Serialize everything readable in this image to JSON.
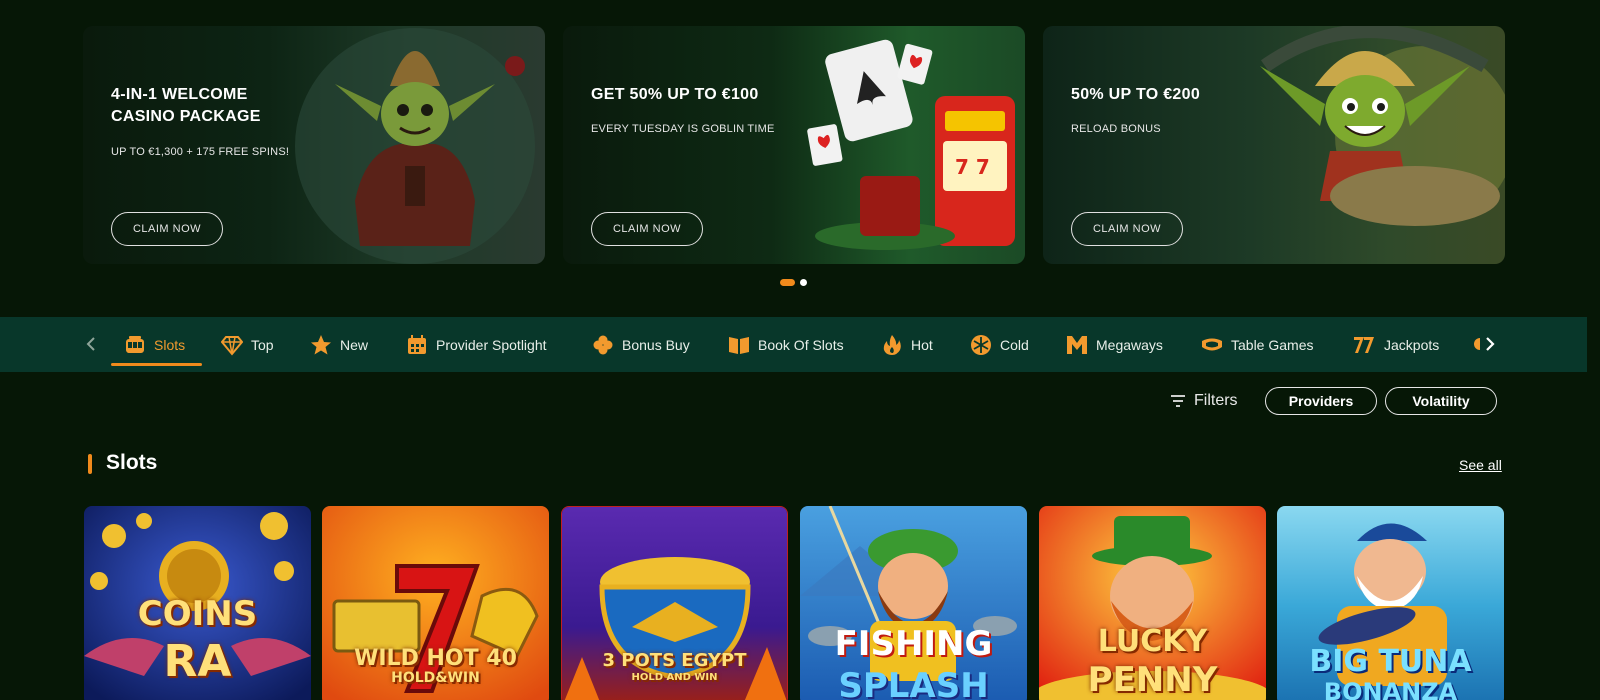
{
  "promos": [
    {
      "title_line1": "4-IN-1 WELCOME",
      "title_line2": "CASINO PACKAGE",
      "subtitle": "UP TO €1,300 + 175 FREE SPINS!",
      "cta": "CLAIM NOW"
    },
    {
      "title_line1": "GET 50% UP TO €100",
      "title_line2": "",
      "subtitle": "EVERY TUESDAY IS GOBLIN TIME",
      "cta": "CLAIM NOW"
    },
    {
      "title_line1": "50% UP TO €200",
      "title_line2": "",
      "subtitle": "RELOAD BONUS",
      "cta": "CLAIM NOW"
    }
  ],
  "carousel": {
    "pages": 2,
    "active_page": 1
  },
  "categories": [
    {
      "label": "Slots",
      "icon": "slot-machine-icon",
      "active": true
    },
    {
      "label": "Top",
      "icon": "diamond-icon"
    },
    {
      "label": "New",
      "icon": "star-icon"
    },
    {
      "label": "Provider Spotlight",
      "icon": "calendar-icon"
    },
    {
      "label": "Bonus Buy",
      "icon": "clover-icon"
    },
    {
      "label": "Book Of Slots",
      "icon": "book-icon"
    },
    {
      "label": "Hot",
      "icon": "flame-icon"
    },
    {
      "label": "Cold",
      "icon": "snowflake-icon"
    },
    {
      "label": "Megaways",
      "icon": "megaways-m-icon"
    },
    {
      "label": "Table Games",
      "icon": "table-games-icon"
    },
    {
      "label": "Jackpots",
      "icon": "sevens-icon"
    }
  ],
  "filters": {
    "label": "Filters",
    "providers": "Providers",
    "volatility": "Volatility"
  },
  "section": {
    "title": "Slots",
    "see_all": "See all"
  },
  "games": [
    {
      "line1": "COINS",
      "line2": "RA"
    },
    {
      "line1": "WILD HOT 40",
      "line2": "HOLD&WIN"
    },
    {
      "line1": "3 POTS EGYPT",
      "line2": "HOLD AND WIN"
    },
    {
      "line1": "FISHING",
      "line2": "SPLASH"
    },
    {
      "line1": "LUCKY",
      "line2": "PENNY"
    },
    {
      "line1": "BIG TUNA",
      "line2": "BONANZA"
    }
  ],
  "colors": {
    "background": "#061706",
    "nav_bar": "#08372a",
    "accent": "#f08a1c"
  }
}
